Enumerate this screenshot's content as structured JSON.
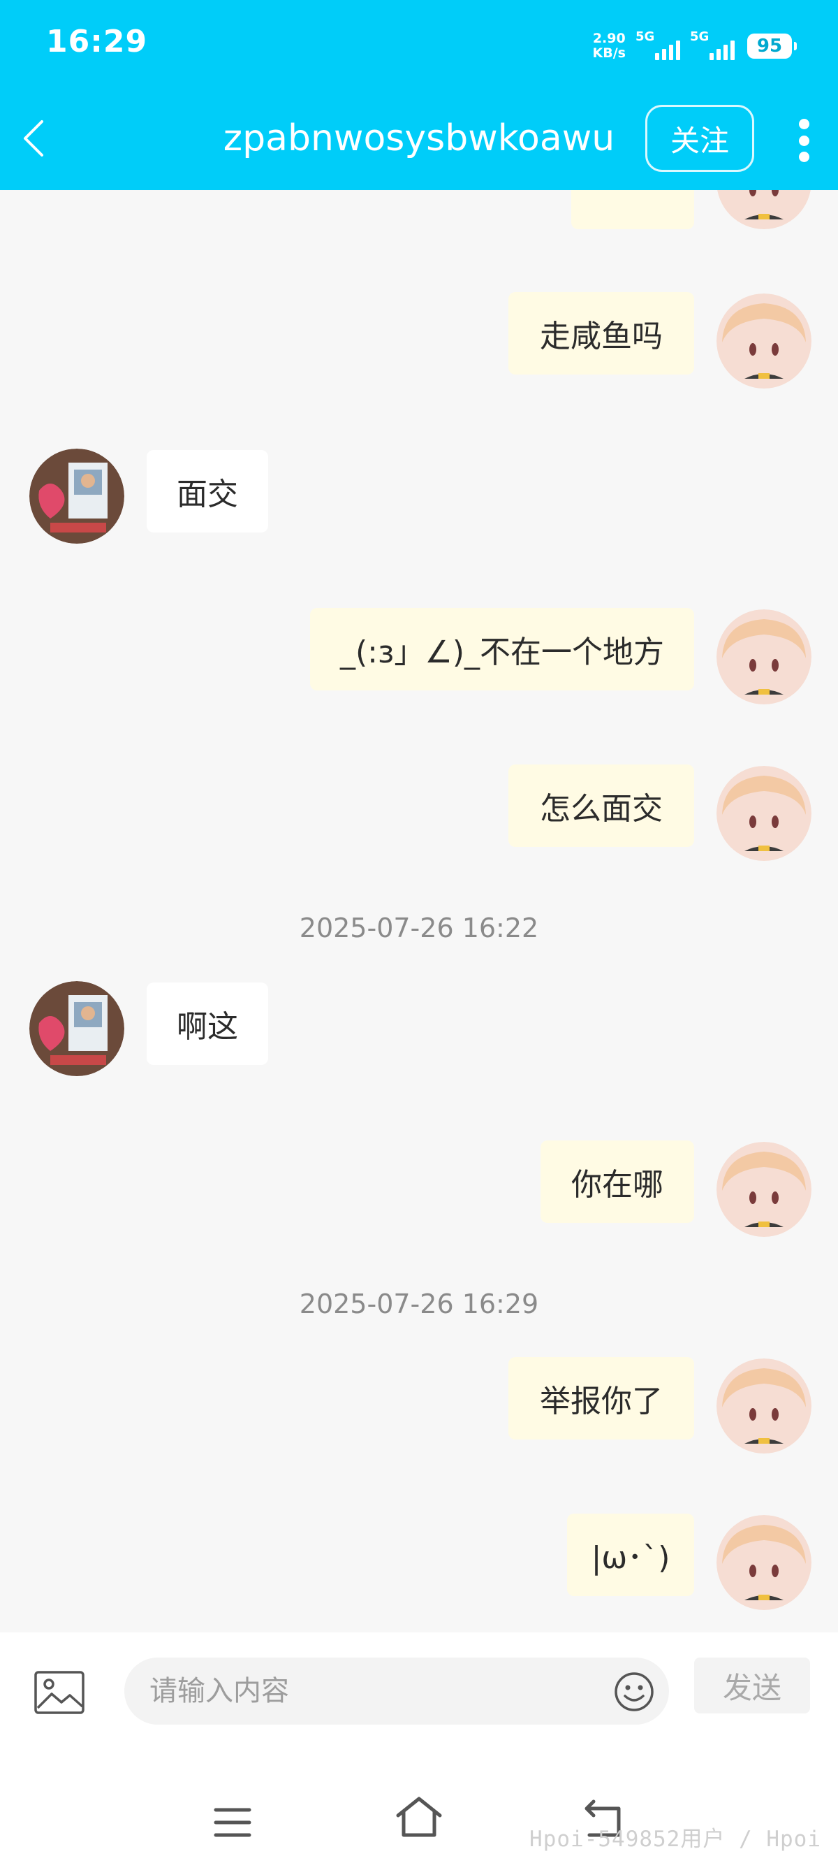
{
  "status_bar": {
    "time": "16:29",
    "net_speed_value": "2.90",
    "net_speed_unit": "KB/s",
    "signal_1": "5G",
    "signal_2": "5G",
    "battery": "95"
  },
  "header": {
    "title": "zpabnwosysbwkoawu",
    "follow_label": "关注",
    "background_color": "#00cdf9"
  },
  "messages": [
    {
      "side": "me",
      "text": "走咸鱼吗"
    },
    {
      "side": "other",
      "text": "面交"
    },
    {
      "side": "me",
      "text": "_(:з」∠)_不在一个地方"
    },
    {
      "side": "me",
      "text": "怎么面交"
    },
    {
      "timestamp": "2025-07-26 16:22"
    },
    {
      "side": "other",
      "text": "啊这"
    },
    {
      "side": "me",
      "text": "你在哪"
    },
    {
      "timestamp": "2025-07-26 16:29"
    },
    {
      "side": "me",
      "text": "举报你了"
    },
    {
      "side": "me",
      "text": "|ω･`)"
    }
  ],
  "input_bar": {
    "placeholder": "请输入内容",
    "send_label": "发送",
    "image_icon": "image-icon",
    "emoji_icon": "emoji-icon"
  },
  "system_nav": {
    "watermark": "Hpoi-549852用户 / Hpoi"
  }
}
